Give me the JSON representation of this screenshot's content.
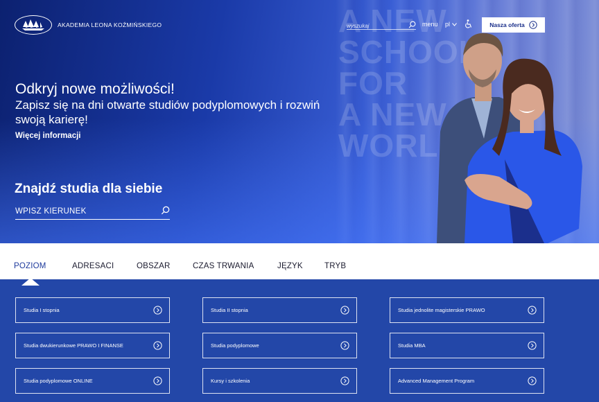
{
  "header": {
    "logo_text": "AKADEMIA LEONA KOŹMIŃSKIEGO",
    "search_placeholder": "wyszukaj",
    "menu_label": "menu",
    "lang_label": "pl",
    "offer_button": "Nasza oferta",
    "icons": {
      "search": "search-icon",
      "accessibility": "accessibility-icon",
      "arrow": "arrow-circle-right-icon",
      "chevron": "chevron-down-icon"
    }
  },
  "hero": {
    "slogan_lines": [
      "A NEW",
      "SCHOOL",
      "FOR",
      "A NEW",
      "WORLD"
    ],
    "title": "Odkryj nowe możliwości!",
    "subtitle": "Zapisz się na dni otwarte studiów podyplomowych i rozwiń swoją karierę!",
    "more_link": "Więcej informacji",
    "find_title": "Znajdź studia dla siebie",
    "find_placeholder": "WPISZ KIERUNEK"
  },
  "tabs": [
    {
      "label": "POZIOM",
      "active": true
    },
    {
      "label": "ADRESACI",
      "active": false
    },
    {
      "label": "OBSZAR",
      "active": false
    },
    {
      "label": "CZAS TRWANIA",
      "active": false
    },
    {
      "label": "JĘZYK",
      "active": false
    },
    {
      "label": "TRYB",
      "active": false
    }
  ],
  "cards": [
    "Studia I stopnia",
    "Studia II stopnia",
    "Studia jednolite magisterskie PRAWO",
    "Studia dwukierunkowe PRAWO I FINANSE",
    "Studia podyplomowe",
    "Studia MBA",
    "Studia podyplomowe ONLINE",
    "Kursy i szkolenia",
    "Advanced Management Program"
  ],
  "colors": {
    "brand_blue": "#1e3a9c",
    "grid_blue": "#2347a8",
    "white": "#ffffff"
  }
}
